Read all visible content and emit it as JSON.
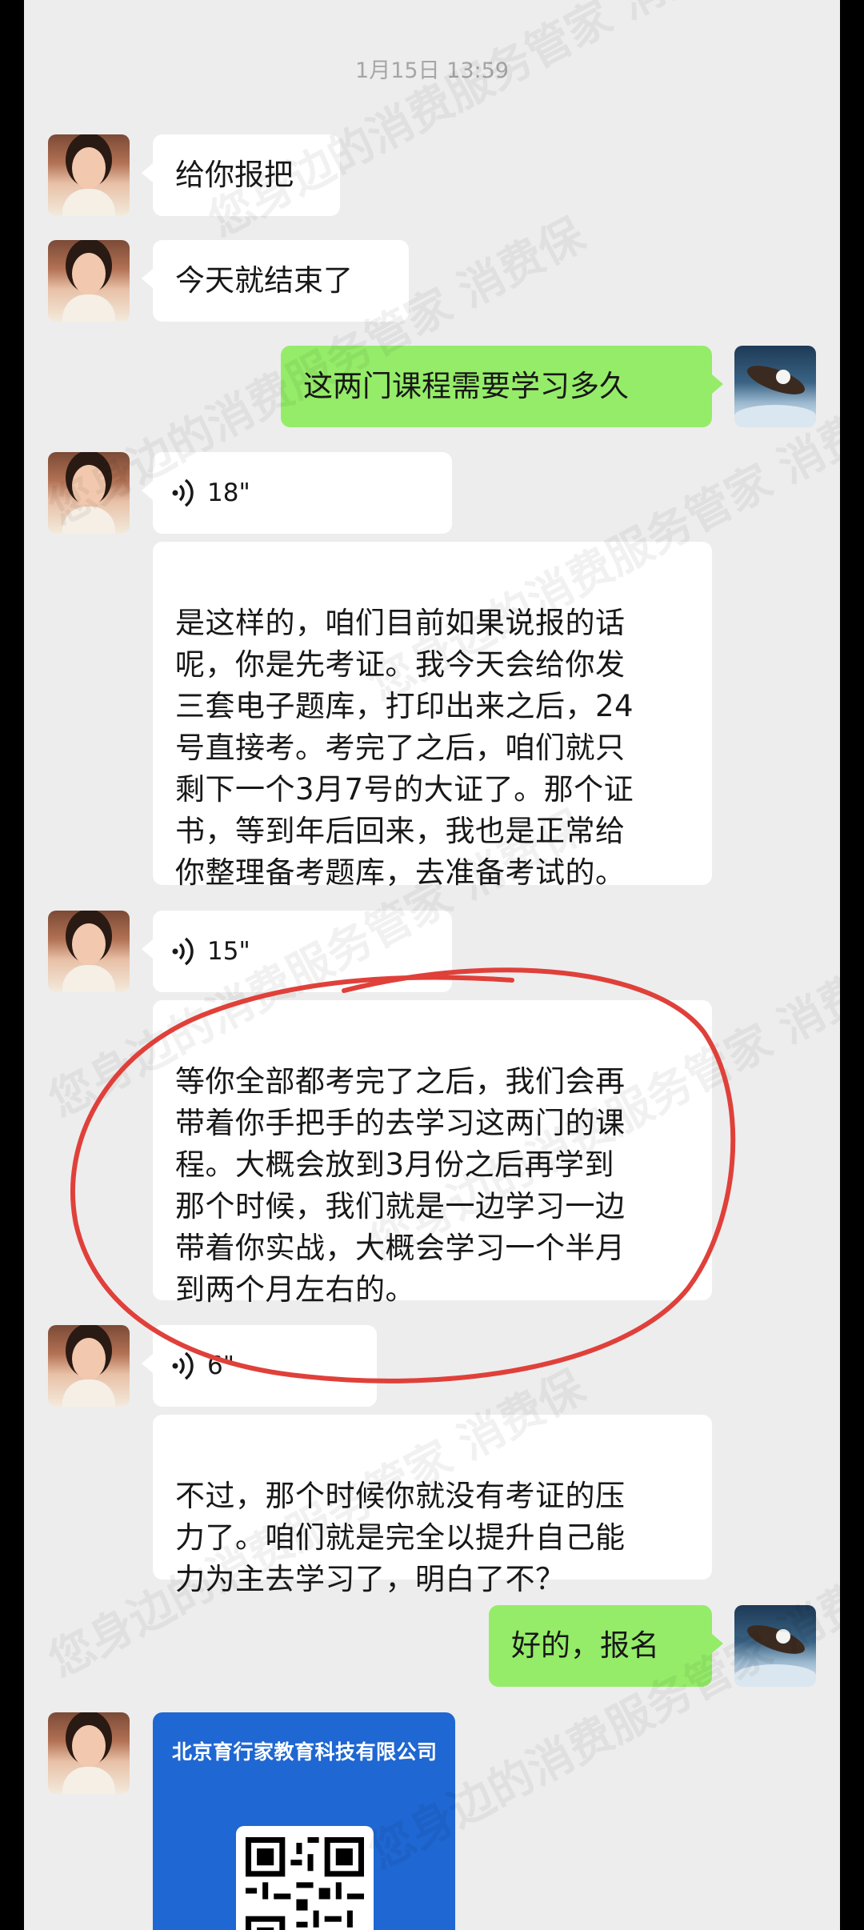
{
  "timestamp": "1月15日 13:59",
  "watermark": "您身边的消费服务管家 消费保",
  "messages": {
    "m1": "给你报把",
    "m2": "今天就结束了",
    "m3": "这两门课程需要学习多久",
    "v1": "18\"",
    "m4": "是这样的，咱们目前如果说报的话\n呢，你是先考证。我今天会给你发\n三套电子题库，打印出来之后，24\n号直接考。考完了之后，咱们就只\n剩下一个3月7号的大证了。那个证\n书，等到年后回来，我也是正常给\n你整理备考题库，去准备考试的。",
    "v2": "15\"",
    "m5": "等你全部都考完了之后，我们会再\n带着你手把手的去学习这两门的课\n程。大概会放到3月份之后再学到\n那个时候，我们就是一边学习一边\n带着你实战，大概会学习一个半月\n到两个月左右的。",
    "v3": "6\"",
    "m6": "不过，那个时候你就没有考证的压\n力了。咱们就是完全以提升自己能\n力为主去学习了，明白了不？",
    "m7": "好的，报名"
  },
  "card": {
    "company": "北京育行家教育科技有限公司"
  },
  "colors": {
    "background": "#ededed",
    "bubble_white": "#ffffff",
    "bubble_green": "#95ec69",
    "card_blue": "#1f67d2",
    "annotation_red": "#e0403a"
  }
}
